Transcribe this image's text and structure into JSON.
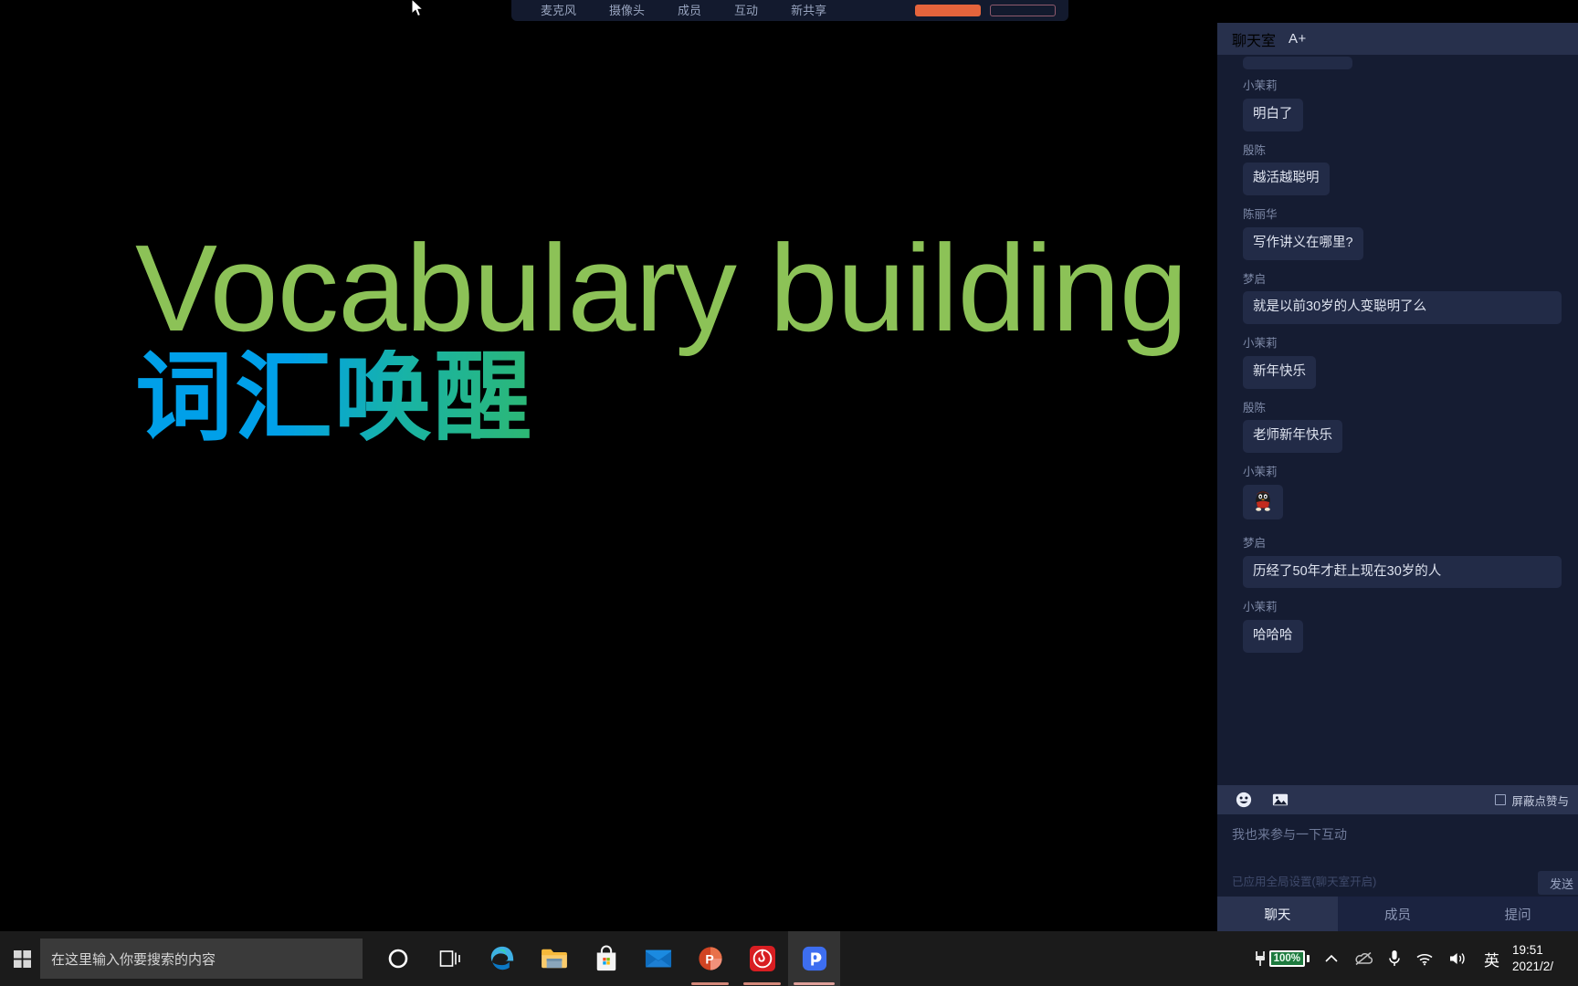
{
  "toolbar": {
    "items": [
      {
        "label": "麦克风",
        "name": "toolbar-microphone"
      },
      {
        "label": "摄像头",
        "name": "toolbar-camera"
      },
      {
        "label": "成员",
        "name": "toolbar-members"
      },
      {
        "label": "互动",
        "name": "toolbar-interaction"
      },
      {
        "label": "新共享",
        "name": "toolbar-new-share"
      }
    ],
    "primary_button_color": "#e5643c",
    "ghost_button_border": "#8f5a6d"
  },
  "slide": {
    "title_en": "Vocabulary building",
    "title_cn": "词汇唤醒",
    "title_en_color": "#8cc257",
    "title_cn_gradient_from": "#00a0e9",
    "title_cn_gradient_to": "#2eb872",
    "background": "#000000"
  },
  "chat": {
    "header": {
      "title": "聊天室",
      "font_size_label": "A+"
    },
    "messages": [
      {
        "author": "小茉莉",
        "text": "明白了",
        "type": "text"
      },
      {
        "author": "殷陈",
        "text": "越活越聪明",
        "type": "text"
      },
      {
        "author": "陈丽华",
        "text": "写作讲义在哪里?",
        "type": "text"
      },
      {
        "author": "梦启",
        "text": "就是以前30岁的人变聪明了么",
        "type": "text"
      },
      {
        "author": "小茉莉",
        "text": "新年快乐",
        "type": "text"
      },
      {
        "author": "殷陈",
        "text": "老师新年快乐",
        "type": "text"
      },
      {
        "author": "小茉莉",
        "text": "",
        "type": "sticker",
        "sticker_name": "qq-penguin-sticker"
      },
      {
        "author": "梦启",
        "text": "历经了50年才赶上现在30岁的人",
        "type": "text"
      },
      {
        "author": "小茉莉",
        "text": "哈哈哈",
        "type": "text"
      }
    ],
    "tools": {
      "emoji_icon": "emoji-icon",
      "image_icon": "image-icon",
      "block_checkbox_label": "屏蔽点赞与",
      "block_checkbox_checked": false
    },
    "input": {
      "placeholder": "我也来参与一下互动",
      "value": "",
      "status_text": "已应用全局设置(聊天室开启)",
      "send_label": "发送"
    },
    "tabs": [
      {
        "label": "聊天",
        "active": true
      },
      {
        "label": "成员",
        "active": false
      },
      {
        "label": "提问",
        "active": false
      }
    ],
    "panel_background": "#151c32",
    "bubble_background": "#222b47"
  },
  "taskbar": {
    "start_icon": "windows-start-icon",
    "search": {
      "placeholder": "在这里输入你要搜索的内容",
      "value": ""
    },
    "icons": [
      {
        "name": "cortana-icon",
        "label": "Cortana"
      },
      {
        "name": "task-view-icon",
        "label": "任务视图"
      },
      {
        "name": "microsoft-edge-icon",
        "label": "Microsoft Edge"
      },
      {
        "name": "file-explorer-icon",
        "label": "文件资源管理器"
      },
      {
        "name": "microsoft-store-icon",
        "label": "Microsoft Store"
      },
      {
        "name": "mail-icon",
        "label": "邮件"
      },
      {
        "name": "powerpoint-icon",
        "label": "PowerPoint"
      },
      {
        "name": "netease-music-icon",
        "label": "网易云音乐"
      },
      {
        "name": "classin-icon",
        "label": "ClassIn"
      }
    ],
    "tray": {
      "battery_percent": "100%",
      "battery_color": "#1d7a3e",
      "chevron_icon": "chevron-up-icon",
      "onedrive_icon": "onedrive-offline-icon",
      "microphone_icon": "microphone-icon",
      "wifi_icon": "wifi-icon",
      "volume_icon": "volume-icon",
      "ime_label": "英"
    },
    "clock": {
      "time": "19:51",
      "date": "2021/2/"
    }
  }
}
